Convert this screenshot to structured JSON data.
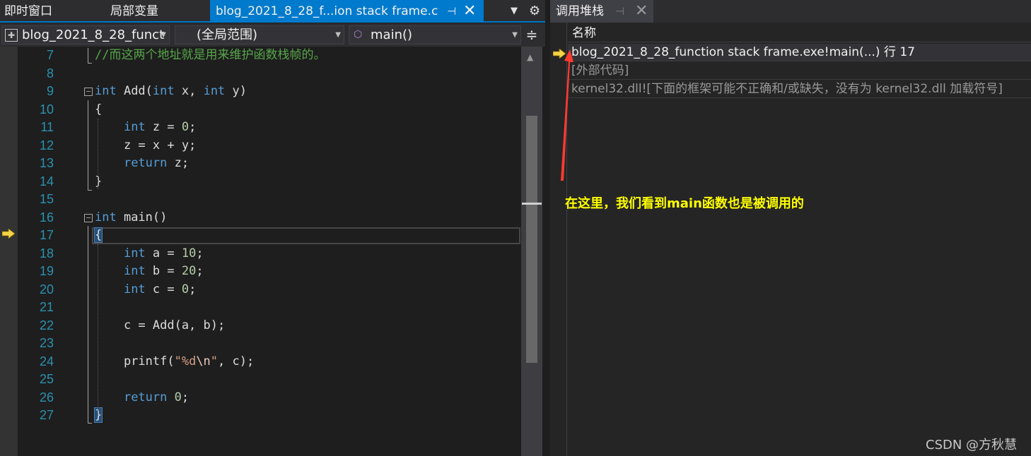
{
  "tabs": {
    "immediate": "即时窗口",
    "locals": "局部变量",
    "active_file": "blog_2021_8_28_f...ion stack frame.c",
    "pin_glyph": "⊣",
    "close_glyph": "✕",
    "dropdown_glyph": "▼",
    "gear_glyph": "⚙"
  },
  "navbar": {
    "project": "blog_2021_8_28_funct",
    "scope": "(全局范围)",
    "function": "main()",
    "func_icon_glyph": "⬡",
    "split_glyph": "≑"
  },
  "editor": {
    "lines": [
      {
        "n": "7",
        "tokens": [
          {
            "c": "cm",
            "t": "//而这两个地址就是用来维护函数栈帧的。"
          }
        ]
      },
      {
        "n": "8",
        "tokens": []
      },
      {
        "n": "9",
        "fold": true,
        "tokens": [
          {
            "c": "kw",
            "t": "int"
          },
          {
            "c": "id",
            "t": " Add("
          },
          {
            "c": "kw",
            "t": "int"
          },
          {
            "c": "id",
            "t": " x, "
          },
          {
            "c": "kw",
            "t": "int"
          },
          {
            "c": "id",
            "t": " y)"
          }
        ]
      },
      {
        "n": "10",
        "tokens": [
          {
            "c": "id",
            "t": "{"
          }
        ]
      },
      {
        "n": "11",
        "tokens": [
          {
            "c": "id",
            "t": "    "
          },
          {
            "c": "kw",
            "t": "int"
          },
          {
            "c": "id",
            "t": " z = "
          },
          {
            "c": "num",
            "t": "0"
          },
          {
            "c": "id",
            "t": ";"
          }
        ]
      },
      {
        "n": "12",
        "tokens": [
          {
            "c": "id",
            "t": "    z = x + y;"
          }
        ]
      },
      {
        "n": "13",
        "tokens": [
          {
            "c": "id",
            "t": "    "
          },
          {
            "c": "kw",
            "t": "return"
          },
          {
            "c": "id",
            "t": " z;"
          }
        ]
      },
      {
        "n": "14",
        "tokens": [
          {
            "c": "id",
            "t": "}"
          }
        ]
      },
      {
        "n": "15",
        "tokens": []
      },
      {
        "n": "16",
        "fold": true,
        "tokens": [
          {
            "c": "kw",
            "t": "int"
          },
          {
            "c": "id",
            "t": " main()"
          }
        ]
      },
      {
        "n": "17",
        "tokens": [
          {
            "c": "id brace-hl",
            "t": "{"
          }
        ]
      },
      {
        "n": "18",
        "tokens": [
          {
            "c": "id",
            "t": "    "
          },
          {
            "c": "kw",
            "t": "int"
          },
          {
            "c": "id",
            "t": " a = "
          },
          {
            "c": "num",
            "t": "10"
          },
          {
            "c": "id",
            "t": ";"
          }
        ]
      },
      {
        "n": "19",
        "tokens": [
          {
            "c": "id",
            "t": "    "
          },
          {
            "c": "kw",
            "t": "int"
          },
          {
            "c": "id",
            "t": " b = "
          },
          {
            "c": "num",
            "t": "20"
          },
          {
            "c": "id",
            "t": ";"
          }
        ]
      },
      {
        "n": "20",
        "tokens": [
          {
            "c": "id",
            "t": "    "
          },
          {
            "c": "kw",
            "t": "int"
          },
          {
            "c": "id",
            "t": " c = "
          },
          {
            "c": "num",
            "t": "0"
          },
          {
            "c": "id",
            "t": ";"
          }
        ]
      },
      {
        "n": "21",
        "tokens": []
      },
      {
        "n": "22",
        "tokens": [
          {
            "c": "id",
            "t": "    c = Add(a, b);"
          }
        ]
      },
      {
        "n": "23",
        "tokens": []
      },
      {
        "n": "24",
        "tokens": [
          {
            "c": "id",
            "t": "    printf("
          },
          {
            "c": "str",
            "t": "\"%d"
          },
          {
            "c": "esc",
            "t": "\\n"
          },
          {
            "c": "str",
            "t": "\""
          },
          {
            "c": "id",
            "t": ", c);"
          }
        ]
      },
      {
        "n": "25",
        "tokens": []
      },
      {
        "n": "26",
        "tokens": [
          {
            "c": "id",
            "t": "    "
          },
          {
            "c": "kw",
            "t": "return"
          },
          {
            "c": "id",
            "t": " "
          },
          {
            "c": "num",
            "t": "0"
          },
          {
            "c": "id",
            "t": ";"
          }
        ]
      },
      {
        "n": "27",
        "tokens": [
          {
            "c": "id brace-hl",
            "t": "}"
          }
        ]
      }
    ],
    "current_line": "17"
  },
  "callstack": {
    "title": "调用堆栈",
    "header": "名称",
    "rows": [
      "blog_2021_8_28_function stack frame.exe!main(...) 行 17",
      "[外部代码]",
      "kernel32.dll![下面的框架可能不正确和/或缺失，没有为 kernel32.dll 加载符号]"
    ]
  },
  "annotation": {
    "text": "在这里，我们看到main函数也是被调用的",
    "color": "#ffff00",
    "arrow_color": "#ff3b30"
  },
  "watermark": "CSDN @方秋慧",
  "icons": {
    "current_statement": "current-statement-arrow-icon",
    "tab_pin": "pin-icon",
    "tab_close": "close-icon",
    "settings": "gear-icon",
    "function": "function-icon"
  },
  "colors": {
    "accent": "#007acc",
    "keyword": "#569cd6",
    "comment": "#57a64a",
    "number": "#b5cea8",
    "string": "#d69d85",
    "line_number": "#2b91af"
  }
}
